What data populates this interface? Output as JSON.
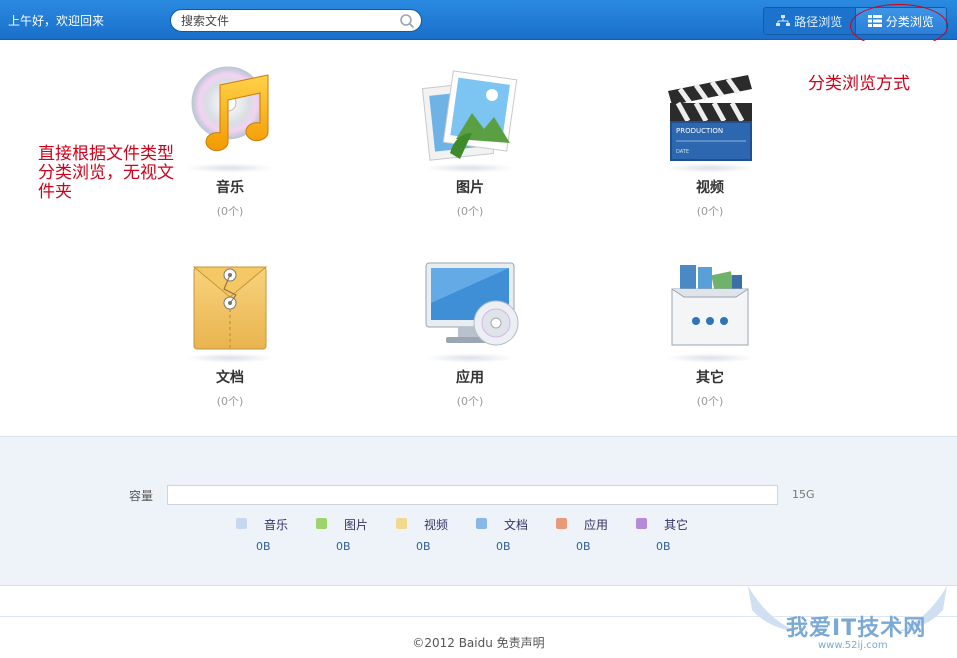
{
  "header": {
    "greeting": "上午好，欢迎回来",
    "search_placeholder": "搜索文件",
    "view_path_label": "路径浏览",
    "view_category_label": "分类浏览"
  },
  "categories": [
    {
      "label": "音乐",
      "count": "(0个)",
      "icon": "music-icon"
    },
    {
      "label": "图片",
      "count": "(0个)",
      "icon": "picture-icon"
    },
    {
      "label": "视频",
      "count": "(0个)",
      "icon": "video-icon"
    },
    {
      "label": "文档",
      "count": "(0个)",
      "icon": "document-icon"
    },
    {
      "label": "应用",
      "count": "(0个)",
      "icon": "application-icon"
    },
    {
      "label": "其它",
      "count": "(0个)",
      "icon": "other-icon"
    }
  ],
  "video_icon_text": {
    "production": "PRODUCTION",
    "date": "DATE"
  },
  "annotations": {
    "left_note_line1": "直接根据文件类型",
    "left_note_line2": "分类浏览，无视文",
    "left_note_line3": "件夹",
    "right_note": "分类浏览方式"
  },
  "capacity": {
    "label": "容量",
    "total": "15G",
    "used_fraction": 0,
    "legend": [
      {
        "name": "音乐",
        "value": "0B",
        "color": "#c6d8f0"
      },
      {
        "name": "图片",
        "value": "0B",
        "color": "#9fd36b"
      },
      {
        "name": "文档",
        "value": "0B",
        "color": "#8ab8e6"
      },
      {
        "name": "视频",
        "value": "0B",
        "color": "#f0d98c"
      },
      {
        "name": "应用",
        "value": "0B",
        "color": "#e89a7a"
      },
      {
        "name": "其它",
        "value": "0B",
        "color": "#b58ad6"
      }
    ]
  },
  "footer": {
    "copyright": "©2012 Baidu 免责声明"
  },
  "watermark": {
    "site": "我爱IT技术网",
    "url": "www.52ij.com"
  }
}
